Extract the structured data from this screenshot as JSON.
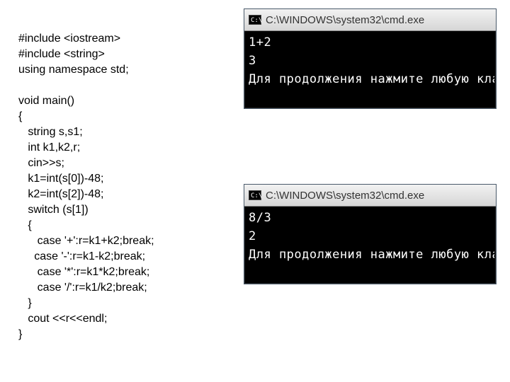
{
  "code": {
    "lines": [
      "#include <iostream>",
      "#include <string>",
      "using namespace std;",
      "",
      "void main()",
      "{",
      "   string s,s1;",
      "   int k1,k2,r;",
      "   cin>>s;",
      "   k1=int(s[0])-48;",
      "   k2=int(s[2])-48;",
      "   switch (s[1])",
      "   {",
      "      case '+':r=k1+k2;break;",
      "     case '-':r=k1-k2;break;",
      "      case '*':r=k1*k2;break;",
      "      case '/':r=k1/k2;break;",
      "   }",
      "   cout <<r<<endl;",
      "}"
    ]
  },
  "console1": {
    "icon_label": "C:\\",
    "title": "C:\\WINDOWS\\system32\\cmd.exe",
    "lines": [
      "1+2",
      "3",
      "Для продолжения нажмите любую клавишу ."
    ]
  },
  "console2": {
    "icon_label": "C:\\",
    "title": "C:\\WINDOWS\\system32\\cmd.exe",
    "lines": [
      "8/3",
      "2",
      "Для продолжения нажмите любую клавишу ."
    ]
  }
}
